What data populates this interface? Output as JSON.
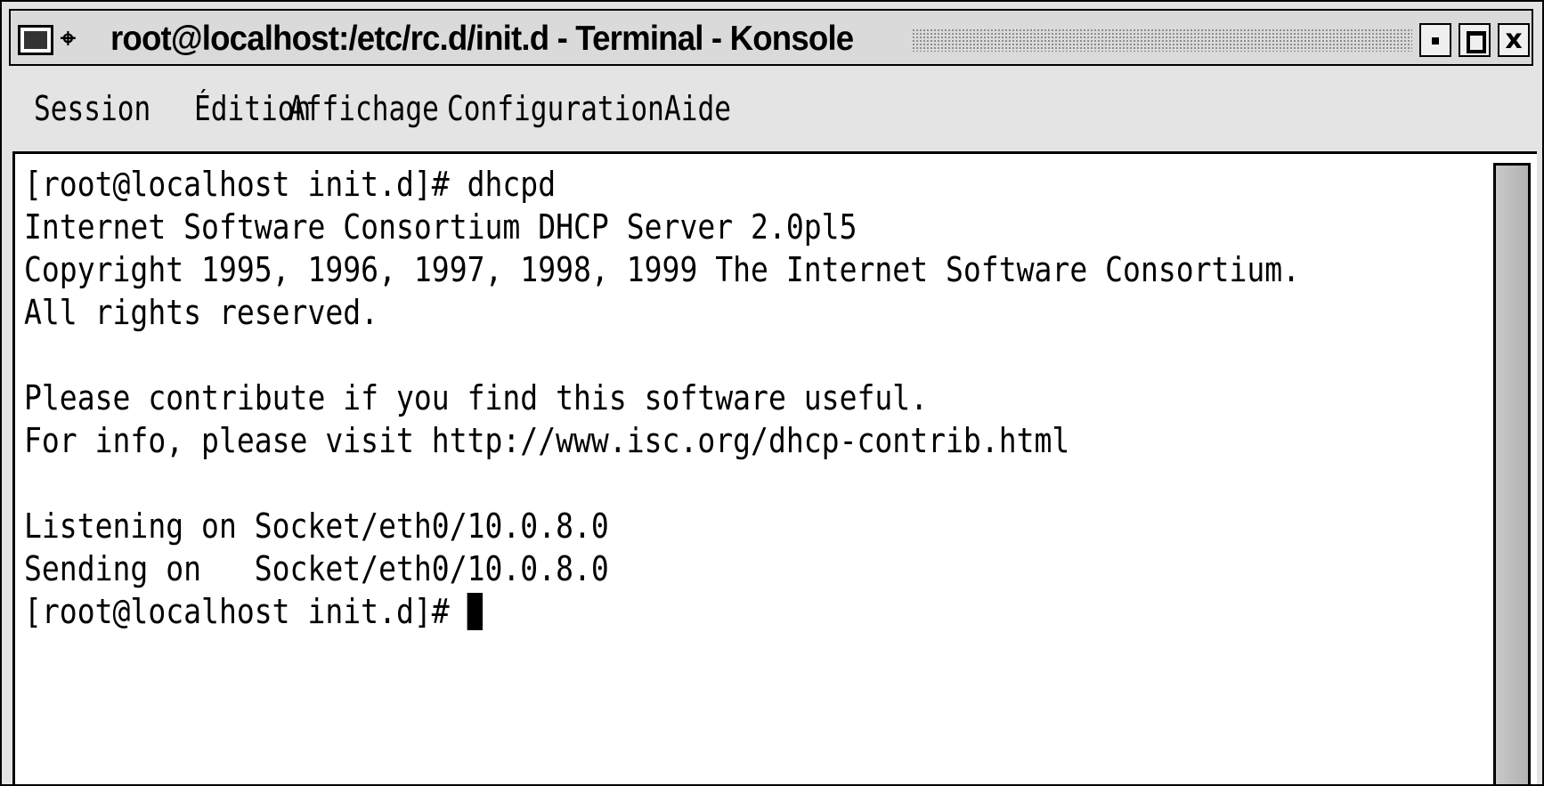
{
  "window": {
    "title": "root@localhost:/etc/rc.d/init.d - Terminal - Konsole",
    "controls": {
      "minimize_icon": "minimize-square-icon",
      "maximize_icon": "maximize-square-icon",
      "close_glyph": "x"
    },
    "system_icon": "terminal-window-icon",
    "pin_icon": "pin-icon",
    "pin_glyph": "⌖"
  },
  "menubar": {
    "items": [
      {
        "label": "Session"
      },
      {
        "label": "Édition"
      },
      {
        "label": "Affichage"
      },
      {
        "label": "Configuration"
      },
      {
        "label": "Aide"
      }
    ]
  },
  "terminal": {
    "lines": [
      "[root@localhost init.d]# dhcpd",
      "Internet Software Consortium DHCP Server 2.0pl5",
      "Copyright 1995, 1996, 1997, 1998, 1999 The Internet Software Consortium.",
      "All rights reserved.",
      "",
      "Please contribute if you find this software useful.",
      "For info, please visit http://www.isc.org/dhcp-contrib.html",
      "",
      "Listening on Socket/eth0/10.0.8.0",
      "Sending on   Socket/eth0/10.0.8.0",
      "[root@localhost init.d]# "
    ],
    "background_color": "#ffffff",
    "text_color": "#000000"
  }
}
